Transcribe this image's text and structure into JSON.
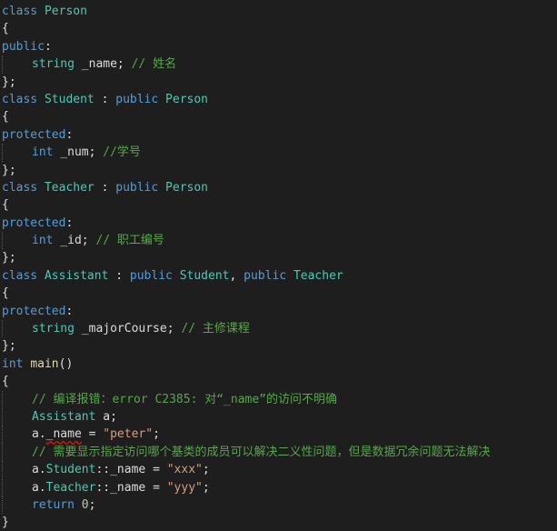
{
  "colors": {
    "background": "#1e1e1e",
    "keyword": "#569cd6",
    "type": "#4ec9b0",
    "function": "#dcdcaa",
    "string": "#d69d85",
    "number": "#b5cea8",
    "comment": "#57a64a",
    "text": "#dcdcdc",
    "error_squiggle": "#e51400"
  },
  "code": {
    "lines": [
      {
        "indent": 0,
        "tokens": [
          {
            "t": "class",
            "c": "kw"
          },
          {
            "t": " "
          },
          {
            "t": "Person",
            "c": "ty"
          }
        ]
      },
      {
        "indent": 0,
        "tokens": [
          {
            "t": "{"
          }
        ]
      },
      {
        "indent": 0,
        "tokens": [
          {
            "t": "public",
            "c": "kw"
          },
          {
            "t": ":"
          }
        ]
      },
      {
        "indent": 1,
        "tokens": [
          {
            "t": "string",
            "c": "ty"
          },
          {
            "t": " _name; "
          },
          {
            "t": "// 姓名",
            "c": "cm"
          }
        ]
      },
      {
        "indent": 0,
        "tokens": [
          {
            "t": "};"
          }
        ]
      },
      {
        "indent": 0,
        "tokens": [
          {
            "t": "class",
            "c": "kw"
          },
          {
            "t": " "
          },
          {
            "t": "Student",
            "c": "ty"
          },
          {
            "t": " : "
          },
          {
            "t": "public",
            "c": "kw"
          },
          {
            "t": " "
          },
          {
            "t": "Person",
            "c": "ty"
          }
        ]
      },
      {
        "indent": 0,
        "tokens": [
          {
            "t": "{"
          }
        ]
      },
      {
        "indent": 0,
        "tokens": [
          {
            "t": "protected",
            "c": "kw"
          },
          {
            "t": ":"
          }
        ]
      },
      {
        "indent": 1,
        "tokens": [
          {
            "t": "int",
            "c": "kw"
          },
          {
            "t": " _num; "
          },
          {
            "t": "//学号",
            "c": "cm"
          }
        ]
      },
      {
        "indent": 0,
        "tokens": [
          {
            "t": "};"
          }
        ]
      },
      {
        "indent": 0,
        "tokens": [
          {
            "t": "class",
            "c": "kw"
          },
          {
            "t": " "
          },
          {
            "t": "Teacher",
            "c": "ty"
          },
          {
            "t": " : "
          },
          {
            "t": "public",
            "c": "kw"
          },
          {
            "t": " "
          },
          {
            "t": "Person",
            "c": "ty"
          }
        ]
      },
      {
        "indent": 0,
        "tokens": [
          {
            "t": "{"
          }
        ]
      },
      {
        "indent": 0,
        "tokens": [
          {
            "t": "protected",
            "c": "kw"
          },
          {
            "t": ":"
          }
        ]
      },
      {
        "indent": 1,
        "tokens": [
          {
            "t": "int",
            "c": "kw"
          },
          {
            "t": " _id; "
          },
          {
            "t": "// 职工编号",
            "c": "cm"
          }
        ]
      },
      {
        "indent": 0,
        "tokens": [
          {
            "t": "};"
          }
        ]
      },
      {
        "indent": 0,
        "tokens": [
          {
            "t": "class",
            "c": "kw"
          },
          {
            "t": " "
          },
          {
            "t": "Assistant",
            "c": "ty"
          },
          {
            "t": " : "
          },
          {
            "t": "public",
            "c": "kw"
          },
          {
            "t": " "
          },
          {
            "t": "Student",
            "c": "ty"
          },
          {
            "t": ", "
          },
          {
            "t": "public",
            "c": "kw"
          },
          {
            "t": " "
          },
          {
            "t": "Teacher",
            "c": "ty"
          }
        ]
      },
      {
        "indent": 0,
        "tokens": [
          {
            "t": "{"
          }
        ]
      },
      {
        "indent": 0,
        "tokens": [
          {
            "t": "protected",
            "c": "kw"
          },
          {
            "t": ":"
          }
        ]
      },
      {
        "indent": 1,
        "tokens": [
          {
            "t": "string",
            "c": "ty"
          },
          {
            "t": " _majorCourse; "
          },
          {
            "t": "// 主修课程",
            "c": "cm"
          }
        ]
      },
      {
        "indent": 0,
        "tokens": [
          {
            "t": "};"
          }
        ]
      },
      {
        "indent": 0,
        "tokens": [
          {
            "t": "int",
            "c": "kw"
          },
          {
            "t": " "
          },
          {
            "t": "main",
            "c": "fn"
          },
          {
            "t": "()"
          }
        ]
      },
      {
        "indent": 0,
        "tokens": [
          {
            "t": "{"
          }
        ]
      },
      {
        "indent": 1,
        "tokens": [
          {
            "t": "// 编译报错：error C2385: 对“_name”的访问不明确",
            "c": "cm"
          }
        ]
      },
      {
        "indent": 1,
        "tokens": [
          {
            "t": "Assistant",
            "c": "ty"
          },
          {
            "t": " a;"
          }
        ]
      },
      {
        "indent": 1,
        "tokens": [
          {
            "t": "a."
          },
          {
            "t": "_name",
            "s": true
          },
          {
            "t": " = "
          },
          {
            "t": "\"peter\"",
            "c": "str"
          },
          {
            "t": ";"
          }
        ]
      },
      {
        "indent": 1,
        "tokens": [
          {
            "t": "// 需要显示指定访问哪个基类的成员可以解决二义性问题，但是数据冗余问题无法解决",
            "c": "cm"
          }
        ]
      },
      {
        "indent": 1,
        "tokens": [
          {
            "t": "a."
          },
          {
            "t": "Student",
            "c": "ty"
          },
          {
            "t": "::_name = "
          },
          {
            "t": "\"xxx\"",
            "c": "str"
          },
          {
            "t": ";"
          }
        ]
      },
      {
        "indent": 1,
        "tokens": [
          {
            "t": "a."
          },
          {
            "t": "Teacher",
            "c": "ty"
          },
          {
            "t": "::_name = "
          },
          {
            "t": "\"yyy\"",
            "c": "str"
          },
          {
            "t": ";"
          }
        ]
      },
      {
        "indent": 1,
        "tokens": [
          {
            "t": "return",
            "c": "kw"
          },
          {
            "t": " "
          },
          {
            "t": "0",
            "c": "num"
          },
          {
            "t": ";"
          }
        ]
      },
      {
        "indent": 0,
        "tokens": [
          {
            "t": "}"
          }
        ]
      }
    ]
  }
}
